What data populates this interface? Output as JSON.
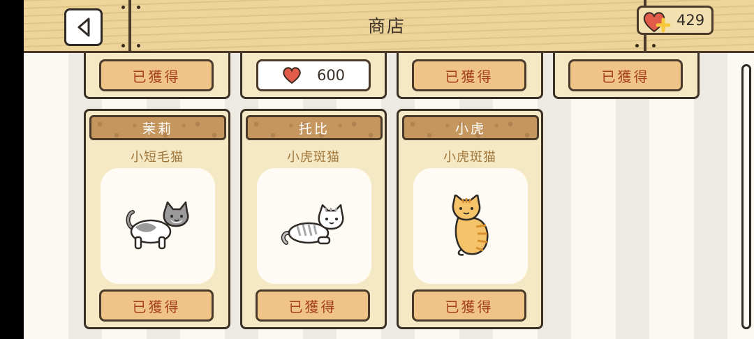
{
  "header": {
    "title": "商店",
    "hearts": "429"
  },
  "top_row": [
    {
      "type": "obtained",
      "label": "已獲得"
    },
    {
      "type": "price",
      "price": "600"
    },
    {
      "type": "obtained",
      "label": "已獲得"
    },
    {
      "type": "obtained",
      "label": "已獲得"
    }
  ],
  "cats": [
    {
      "name": "茉莉",
      "breed": "小短毛猫",
      "status": "已獲得",
      "portrait_icon": "gray-white-shorthair-cat-icon"
    },
    {
      "name": "托比",
      "breed": "小虎斑猫",
      "status": "已獲得",
      "portrait_icon": "gray-tabby-cat-icon"
    },
    {
      "name": "小虎",
      "breed": "小虎斑猫",
      "status": "已獲得",
      "portrait_icon": "orange-tabby-cat-icon"
    }
  ],
  "colors": {
    "wood": "#ecd49a",
    "card": "#f4e9c4",
    "button": "#f0c389",
    "button_text": "#a4401b",
    "heart": "#e25a4a"
  }
}
